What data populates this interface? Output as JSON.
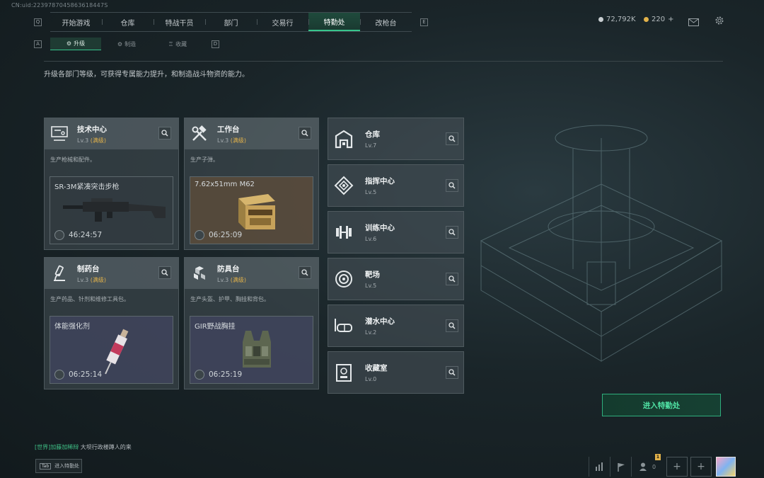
{
  "uid": "CN:uid:2239787045863618447S",
  "nav": {
    "left_key": "Q",
    "right_key": "E",
    "tabs": [
      "开始游戏",
      "仓库",
      "特战干员",
      "部门",
      "交易行",
      "特勤处",
      "改枪台"
    ],
    "active": "特勤处"
  },
  "resources": {
    "currency": "72,792K",
    "premium": "220",
    "premium_add": "+"
  },
  "subnav": {
    "left_key": "A",
    "right_key": "D",
    "tabs": [
      "升级",
      "制造",
      "收藏"
    ]
  },
  "description": "升级各部门等级，可获得专属能力提升，和制造战斗物资的能力。",
  "cards": [
    {
      "name": "技术中心",
      "level": "Lv.3",
      "max": "(满级)",
      "desc": "生产枪械和配件。",
      "product": "SR-3M紧凑突击步枪",
      "timer": "46:24:57",
      "icon": "tech-center-icon"
    },
    {
      "name": "工作台",
      "level": "Lv.3",
      "max": "(满级)",
      "desc": "生产子弹。",
      "product": "7.62x51mm M62",
      "timer": "06:25:09",
      "icon": "workbench-icon"
    },
    {
      "name": "制药台",
      "level": "Lv.3",
      "max": "(满级)",
      "desc": "生产药品、针剂和维修工具包。",
      "product": "体能强化剂",
      "timer": "06:25:14",
      "icon": "pharmacy-icon"
    },
    {
      "name": "防具台",
      "level": "Lv.3",
      "max": "(满级)",
      "desc": "生产头盔、护甲、胸挂和背包。",
      "product": "GIR野战胸挂",
      "timer": "06:25:19",
      "icon": "armor-bench-icon"
    }
  ],
  "small_cards": [
    {
      "name": "仓库",
      "level": "Lv.7",
      "icon": "warehouse-icon"
    },
    {
      "name": "指挥中心",
      "level": "Lv.5",
      "icon": "command-center-icon"
    },
    {
      "name": "训练中心",
      "level": "Lv.6",
      "icon": "training-center-icon"
    },
    {
      "name": "靶场",
      "level": "Lv.5",
      "icon": "shooting-range-icon"
    },
    {
      "name": "潜水中心",
      "level": "Lv.2",
      "icon": "diving-center-icon"
    },
    {
      "name": "收藏室",
      "level": "Lv.0",
      "icon": "collection-room-icon"
    }
  ],
  "enter_button": "进入特勤处",
  "chat": {
    "channel": "[世界]",
    "user": "加藤加稀辩",
    "message": "大坝行政楼蹲人的来"
  },
  "tab_hint": {
    "key": "Tab",
    "label": "进入特勤处"
  },
  "bottom": {
    "friends_count": "0",
    "badge": "1"
  },
  "colors": {
    "accent": "#37c58c",
    "max_level": "#e2b24a"
  }
}
